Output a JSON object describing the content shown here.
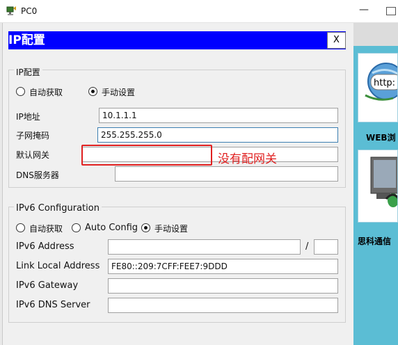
{
  "window": {
    "title": "PC0",
    "minimize_glyph": "—"
  },
  "dialog": {
    "title": "IP配置",
    "close_label": "X"
  },
  "ipv4": {
    "legend": "IP配置",
    "radio_dhcp_label": "自动获取",
    "radio_static_label": "手动设置",
    "selected_mode": "static",
    "ip_label": "IP地址",
    "ip_value": "10.1.1.1",
    "mask_label": "子网掩码",
    "mask_value": "255.255.255.0",
    "gateway_label": "默认网关",
    "gateway_value": "",
    "dns_label": "DNS服务器",
    "dns_value": ""
  },
  "ipv6": {
    "legend": "IPv6 Configuration",
    "radio_auto_label": "自动获取",
    "radio_autoconfig_label": "Auto Config",
    "radio_static_label": "手动设置",
    "selected_mode": "static",
    "address_label": "IPv6 Address",
    "address_value": "",
    "prefix_separator": "/",
    "prefix_value": "",
    "link_local_label": "Link Local Address",
    "link_local_value": "FE80::209:7CFF:FEE7:9DDD",
    "gateway_label": "IPv6 Gateway",
    "gateway_value": "",
    "dns_label": "IPv6 DNS Server",
    "dns_value": ""
  },
  "annotation": {
    "text": "没有配网关",
    "color": "#e02020"
  },
  "side_panel": {
    "web_tile_text": "http:",
    "web_label": "WEB浏",
    "pc_label": "思科通信"
  },
  "colors": {
    "dialog_header": "#0000ff",
    "side_panel": "#5bbdd4"
  }
}
